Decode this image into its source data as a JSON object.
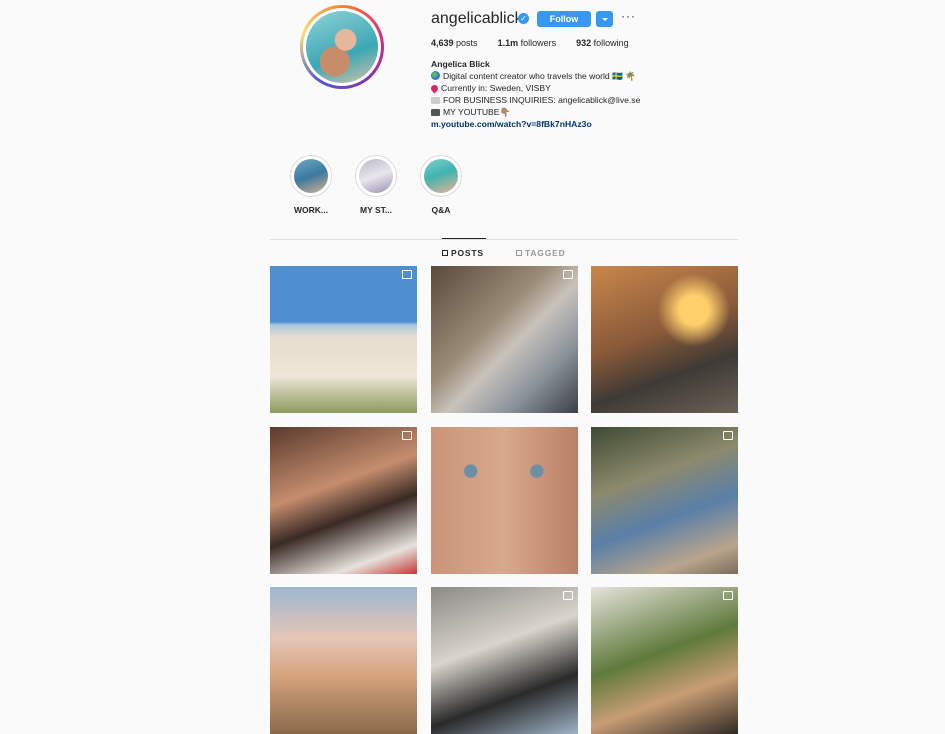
{
  "profile": {
    "username": "angelicablick",
    "verified": true,
    "follow_label": "Follow",
    "more_label": "···",
    "stats": {
      "posts_count": "4,639",
      "posts_label": "posts",
      "followers_count": "1.1m",
      "followers_label": "followers",
      "following_count": "932",
      "following_label": "following"
    },
    "bio": {
      "name": "Angelica Blick",
      "lines": [
        "Digital content creator who travels the world 🇸🇪 🌴",
        "Currently in: Sweden, VISBY",
        "FOR BUSINESS INQUIRIES: angelicablick@live.se",
        "MY YOUTUBE👇🏽"
      ],
      "link": "m.youtube.com/watch?v=8fBk7nHAz3o"
    }
  },
  "highlights": [
    {
      "label": "WORK..."
    },
    {
      "label": "MY ST..."
    },
    {
      "label": "Q&A"
    }
  ],
  "tabs": {
    "posts": "POSTS",
    "tagged": "TAGGED",
    "active": "posts"
  },
  "posts_count_visible": 9,
  "colors": {
    "accent": "#3897f0",
    "link": "#003569",
    "background": "#fafafa"
  }
}
